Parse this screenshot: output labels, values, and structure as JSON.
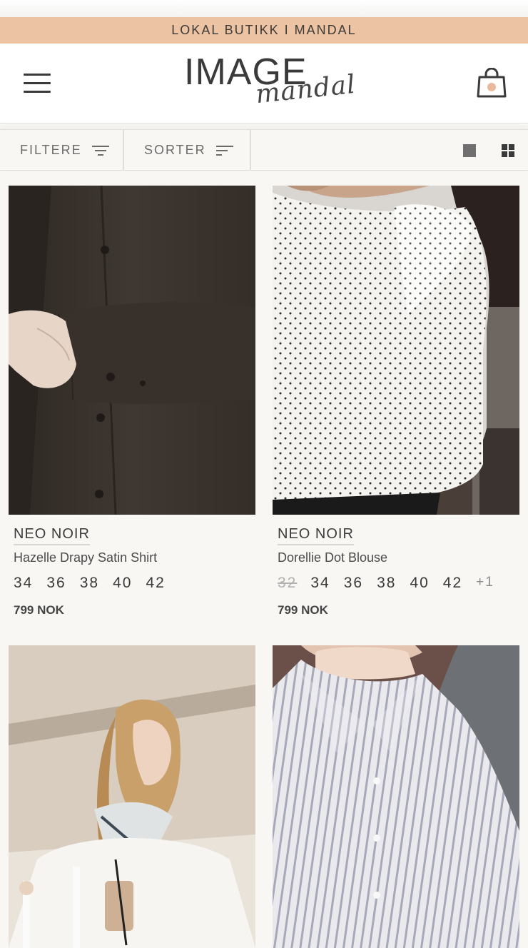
{
  "announcement": "LOKAL BUTIKK I MANDAL",
  "logo": {
    "main": "IMAGE",
    "script": "mandal"
  },
  "toolbar": {
    "filter_label": "FILTERE",
    "sort_label": "SORTER"
  },
  "colors": {
    "announcement_bg": "#ecc3a3",
    "cart_dot": "#e8b99a"
  },
  "products": [
    {
      "brand": "NEO NOIR",
      "name": "Hazelle Drapy Satin Shirt",
      "sizes": [
        "34",
        "36",
        "38",
        "40",
        "42"
      ],
      "price": "799 NOK"
    },
    {
      "brand": "NEO NOIR",
      "name": "Dorellie Dot Blouse",
      "sizes_unavailable": [
        "32"
      ],
      "sizes": [
        "34",
        "36",
        "38",
        "40",
        "42"
      ],
      "more": "+1",
      "price": "799 NOK"
    }
  ]
}
